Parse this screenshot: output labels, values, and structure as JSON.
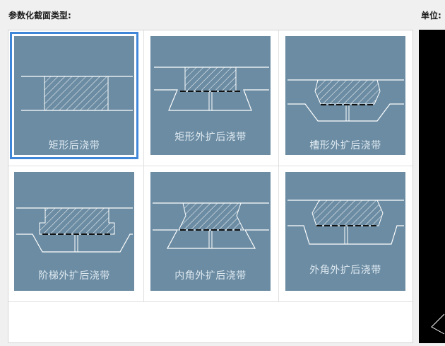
{
  "header": {
    "title": "参数化截面类型:",
    "unit_label": "单位:"
  },
  "colors": {
    "tile_bg": "#6b8ca3",
    "selected_border": "#3f86d8",
    "line": "#ffffff"
  },
  "options": [
    {
      "label": "矩形后浇带",
      "icon": "rect-post-pour-icon",
      "selected": true
    },
    {
      "label": "矩形外扩后浇带",
      "icon": "rect-expanded-post-pour-icon",
      "selected": false
    },
    {
      "label": "槽形外扩后浇带",
      "icon": "groove-expanded-post-pour-icon",
      "selected": false
    },
    {
      "label": "阶梯外扩后浇带",
      "icon": "step-expanded-post-pour-icon",
      "selected": false
    },
    {
      "label": "内角外扩后浇带",
      "icon": "inner-corner-expanded-post-pour-icon",
      "selected": false
    },
    {
      "label": "外角外扩后浇带",
      "icon": "outer-corner-expanded-post-pour-icon",
      "selected": false
    }
  ]
}
